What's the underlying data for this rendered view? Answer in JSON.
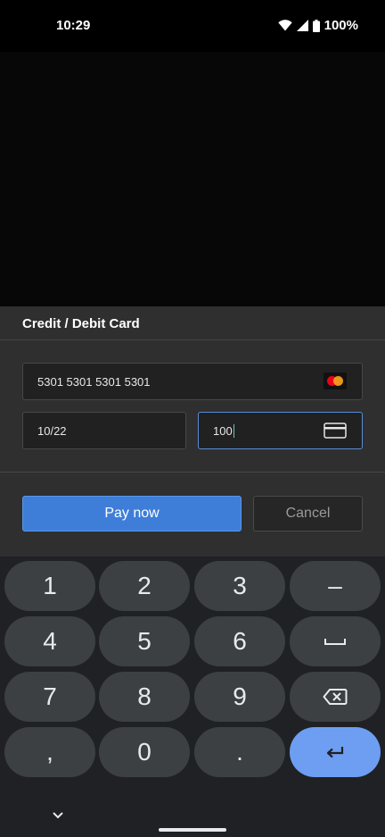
{
  "status_bar": {
    "time": "10:29",
    "battery": "100%"
  },
  "sheet": {
    "title": "Credit / Debit Card",
    "card_number": "5301 5301 5301 5301",
    "expiry": "10/22",
    "cvc": "100",
    "card_brand_icon": "mastercard-logo",
    "cvc_icon": "card-icon"
  },
  "buttons": {
    "pay": "Pay now",
    "cancel": "Cancel"
  },
  "keyboard": {
    "row1": [
      "1",
      "2",
      "3",
      "–"
    ],
    "row2": [
      "4",
      "5",
      "6"
    ],
    "row3": [
      "7",
      "8",
      "9"
    ],
    "row4": [
      ",",
      "0",
      "."
    ]
  },
  "colors": {
    "accent": "#3e7ed9",
    "enter_key": "#6d9ef2",
    "focus_border": "#5a8ed6"
  }
}
